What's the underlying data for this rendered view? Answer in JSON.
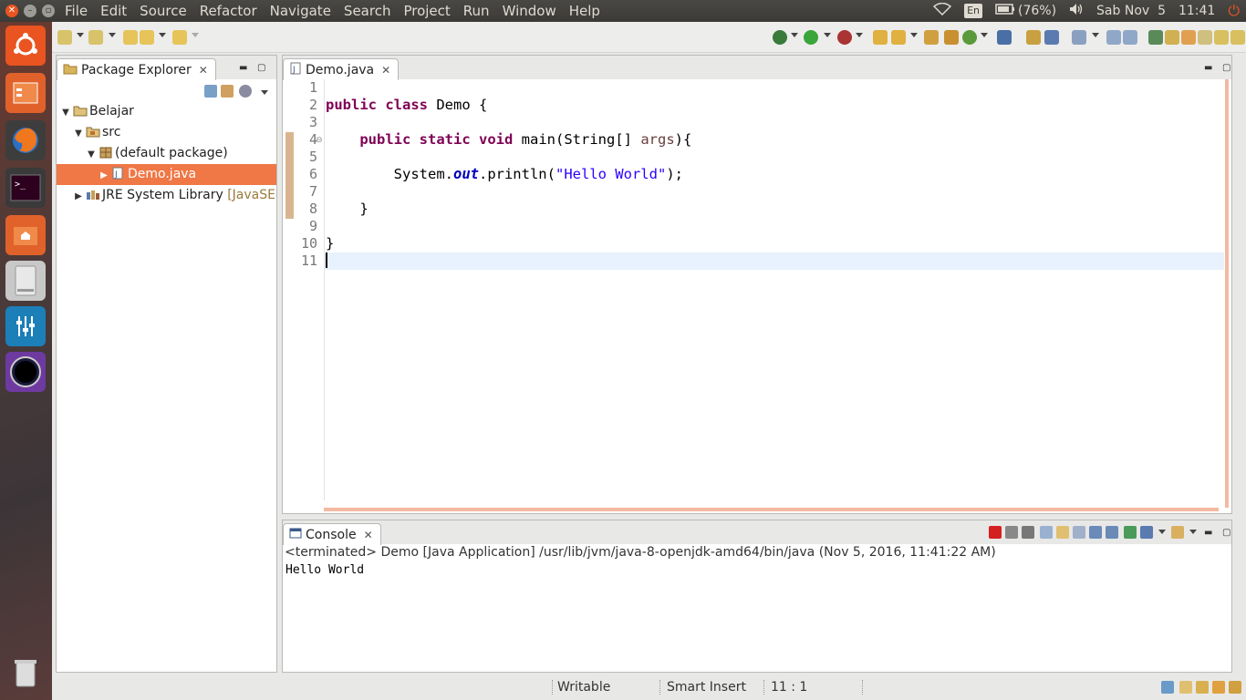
{
  "top_panel": {
    "menu": [
      "File",
      "Edit",
      "Source",
      "Refactor",
      "Navigate",
      "Search",
      "Project",
      "Run",
      "Window",
      "Help"
    ],
    "keyboard_layout": "En",
    "battery": "(76%)",
    "date": "Sab Nov  5",
    "time": "11:41"
  },
  "launcher": {
    "icons": [
      "ubuntu-dash-icon",
      "files-icon",
      "firefox-icon",
      "terminal-icon",
      "home-folder-icon",
      "drive-icon",
      "mixer-icon",
      "eclipse-icon",
      "trash-icon"
    ]
  },
  "package_explorer": {
    "tab_label": "Package Explorer",
    "tree": [
      {
        "label": "Belajar",
        "level": 0,
        "expanded": true,
        "icon": "project-folder-icon"
      },
      {
        "label": "src",
        "level": 1,
        "expanded": true,
        "icon": "source-folder-icon"
      },
      {
        "label": "(default package)",
        "level": 2,
        "expanded": true,
        "icon": "package-icon"
      },
      {
        "label": "Demo.java",
        "level": 3,
        "expanded": false,
        "selected": true,
        "icon": "java-file-icon"
      },
      {
        "label": "JRE System Library",
        "suffix": "[JavaSE-",
        "level": 1,
        "expanded": false,
        "icon": "library-icon"
      }
    ]
  },
  "editor": {
    "tab_label": "Demo.java",
    "line_numbers": [
      "1",
      "2",
      "3",
      "4",
      "5",
      "6",
      "7",
      "8",
      "9",
      "10",
      "11"
    ],
    "code": {
      "line2_kw1": "public",
      "line2_kw2": "class",
      "line2_rest": " Demo {",
      "line4_kw1": "public",
      "line4_kw2": "static",
      "line4_kw3": "void",
      "line4_mid": " main(String[] ",
      "line4_param": "args",
      "line4_end": "){",
      "line6_a": "System.",
      "line6_field": "out",
      "line6_b": ".println(",
      "line6_str": "\"Hello World\"",
      "line6_c": ");",
      "line8": "    }",
      "line10": "}"
    }
  },
  "console": {
    "tab_label": "Console",
    "status": "<terminated> Demo [Java Application] /usr/lib/jvm/java-8-openjdk-amd64/bin/java (Nov 5, 2016, 11:41:22 AM)",
    "output": "Hello World"
  },
  "statusbar": {
    "writable": "Writable",
    "insert_mode": "Smart Insert",
    "position": "11 : 1"
  },
  "colors": {
    "ubuntu_orange": "#e95420",
    "selection": "#f07746",
    "keyword": "#7f0055",
    "string": "#2a00ff"
  }
}
